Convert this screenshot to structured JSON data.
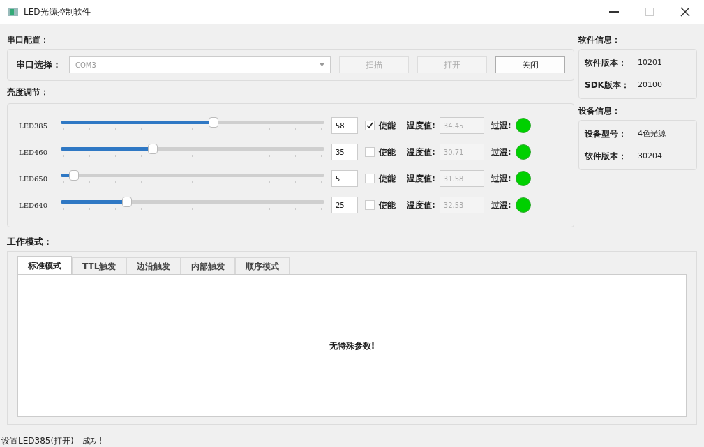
{
  "window": {
    "title": "LED光源控制软件"
  },
  "serial": {
    "heading": "串口配置：",
    "label": "串口选择：",
    "port": "COM3",
    "buttons": [
      {
        "label": "扫描",
        "disabled": true
      },
      {
        "label": "打开",
        "disabled": true
      },
      {
        "label": "关闭",
        "disabled": false
      }
    ]
  },
  "brightness": {
    "heading": "亮度调节：",
    "channels": [
      {
        "name": "LED385",
        "level": 0.58,
        "value": "58",
        "enabled": true,
        "enable_label": "使能",
        "temp_label": "温度值:",
        "temperature": "34.45",
        "over_label": "过温:",
        "color": "#00d000"
      },
      {
        "name": "LED460",
        "level": 0.35,
        "value": "35",
        "enabled": false,
        "enable_label": "使能",
        "temp_label": "温度值:",
        "temperature": "30.71",
        "over_label": "过温:",
        "color": "#00d000"
      },
      {
        "name": "LED650",
        "level": 0.05,
        "value": "5",
        "enabled": false,
        "enable_label": "使能",
        "temp_label": "温度值:",
        "temperature": "31.58",
        "over_label": "过温:",
        "color": "#00d000"
      },
      {
        "name": "LED640",
        "level": 0.25,
        "value": "25",
        "enabled": false,
        "enable_label": "使能",
        "temp_label": "温度值:",
        "temperature": "32.53",
        "over_label": "过温:",
        "color": "#00d000"
      }
    ]
  },
  "software_info": {
    "heading": "软件信息：",
    "rows": [
      {
        "label": "软件版本：",
        "value": "10201"
      },
      {
        "label": "SDK版本：",
        "value": "20100"
      }
    ]
  },
  "device_info": {
    "heading": "设备信息：",
    "rows": [
      {
        "label": "设备型号：",
        "value": "4色光源"
      },
      {
        "label": "软件版本：",
        "value": "30204"
      }
    ]
  },
  "work_mode": {
    "heading": "工作模式：",
    "tabs": [
      {
        "label": "标准模式",
        "selected": true
      },
      {
        "label": "TTL触发",
        "selected": false
      },
      {
        "label": "边沿触发",
        "selected": false
      },
      {
        "label": "内部触发",
        "selected": false
      },
      {
        "label": "顺序模式",
        "selected": false
      }
    ],
    "content": "无特殊参数!"
  },
  "status_bar": "设置LED385(打开) - 成功!"
}
